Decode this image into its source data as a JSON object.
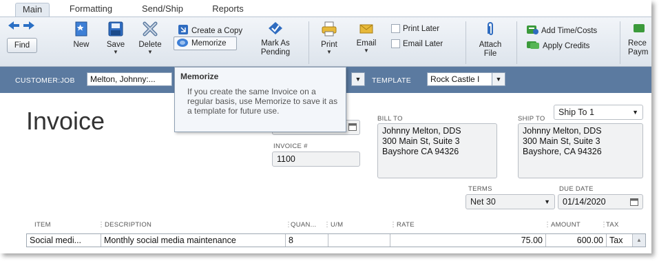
{
  "tabs": [
    {
      "label": "Main",
      "active": true
    },
    {
      "label": "Formatting"
    },
    {
      "label": "Send/Ship"
    },
    {
      "label": "Reports"
    }
  ],
  "ribbon": {
    "find": "Find",
    "new": "New",
    "save": "Save",
    "delete": "Delete",
    "create_copy": "Create a Copy",
    "memorize": "Memorize",
    "mark_as_pending_1": "Mark As",
    "mark_as_pending_2": "Pending",
    "print": "Print",
    "email": "Email",
    "print_later": "Print Later",
    "email_later": "Email Later",
    "attach_file_1": "Attach",
    "attach_file_2": "File",
    "add_time_costs": "Add Time/Costs",
    "apply_credits": "Apply Credits",
    "receive_payments_1": "Rece",
    "receive_payments_2": "Paym"
  },
  "customer_bar": {
    "customer_label": "CUSTOMER:JOB",
    "customer_value": "Melton, Johnny:...",
    "template_label": "TEMPLATE",
    "template_value": "Rock Castle I"
  },
  "tooltip": {
    "title": "Memorize",
    "body": "If you create the same Invoice on a regular basis, use Memorize to save it as a template for future use."
  },
  "form": {
    "title": "Invoice",
    "invoice_no_label": "INVOICE #",
    "invoice_no": "1100",
    "bill_to_label": "BILL TO",
    "bill_to": [
      "Johnny Melton, DDS",
      "300 Main St, Suite 3",
      "Bayshore CA 94326"
    ],
    "ship_to_label": "SHIP TO",
    "ship_to_select": "Ship To 1",
    "ship_to": [
      "Johnny Melton, DDS",
      "300 Main St, Suite 3",
      "Bayshore, CA 94326"
    ],
    "terms_label": "TERMS",
    "terms": "Net 30",
    "due_date_label": "DUE DATE",
    "due_date": "01/14/2020"
  },
  "line_items": {
    "headers": [
      "ITEM",
      "DESCRIPTION",
      "QUAN...",
      "U/M",
      "RATE",
      "AMOUNT",
      "TAX"
    ],
    "rows": [
      {
        "item": "Social medi...",
        "description": "Monthly social media maintenance",
        "quantity": "8",
        "um": "",
        "rate": "75.00",
        "amount": "600.00",
        "tax": "Tax"
      }
    ]
  },
  "colors": {
    "customer_bar": "#5b7aa0",
    "ribbon_bg": "#e4eaf1",
    "accent_blue": "#2a6fc4",
    "green": "#3b9a3b"
  }
}
